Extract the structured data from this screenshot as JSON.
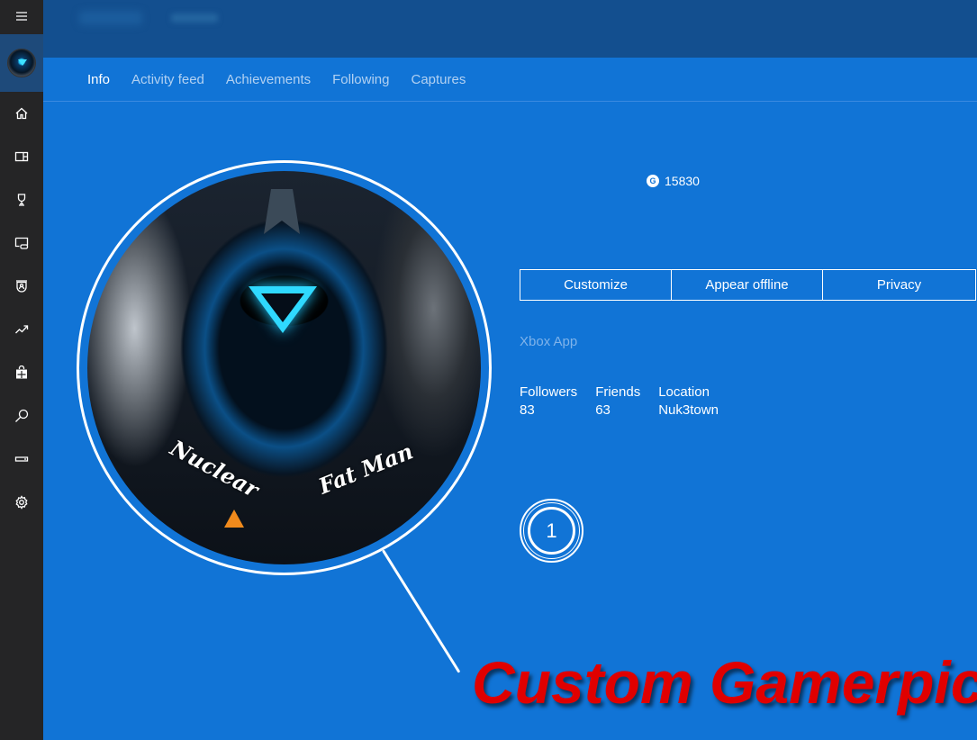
{
  "sidebar": {
    "menu_icon": "hamburger-menu-icon",
    "avatar_icon": "gamerpic-avatar",
    "items": [
      {
        "name": "home",
        "icon": "home-icon"
      },
      {
        "name": "my-games",
        "icon": "games-collection-icon"
      },
      {
        "name": "achievements",
        "icon": "trophy-icon"
      },
      {
        "name": "game-dvr",
        "icon": "game-dvr-icon"
      },
      {
        "name": "clubs",
        "icon": "clubs-shield-icon"
      },
      {
        "name": "trending",
        "icon": "trending-icon"
      },
      {
        "name": "store",
        "icon": "store-bag-icon"
      },
      {
        "name": "search",
        "icon": "search-icon"
      },
      {
        "name": "connection",
        "icon": "console-icon"
      },
      {
        "name": "settings",
        "icon": "gear-icon"
      }
    ]
  },
  "tabs": [
    {
      "label": "Info",
      "active": true
    },
    {
      "label": "Activity feed",
      "active": false
    },
    {
      "label": "Achievements",
      "active": false
    },
    {
      "label": "Following",
      "active": false
    },
    {
      "label": "Captures",
      "active": false
    }
  ],
  "profile": {
    "gamerpic_text_left": "Nuclear",
    "gamerpic_text_right": "Fat Man",
    "gamerscore_icon": "G",
    "gamerscore": "15830",
    "actions": [
      {
        "label": "Customize"
      },
      {
        "label": "Appear offline"
      },
      {
        "label": "Privacy"
      }
    ],
    "bio": "Xbox App",
    "stats": [
      {
        "label": "Followers",
        "value": "83"
      },
      {
        "label": "Friends",
        "value": "63"
      },
      {
        "label": "Location",
        "value": "Nuk3town"
      }
    ],
    "reputation_level": "1"
  },
  "annotation": {
    "text": "Custom Gamerpic",
    "color": "#e00000"
  },
  "colors": {
    "accent": "#1174d6",
    "header": "#134f8f",
    "sidebar": "#252526"
  }
}
